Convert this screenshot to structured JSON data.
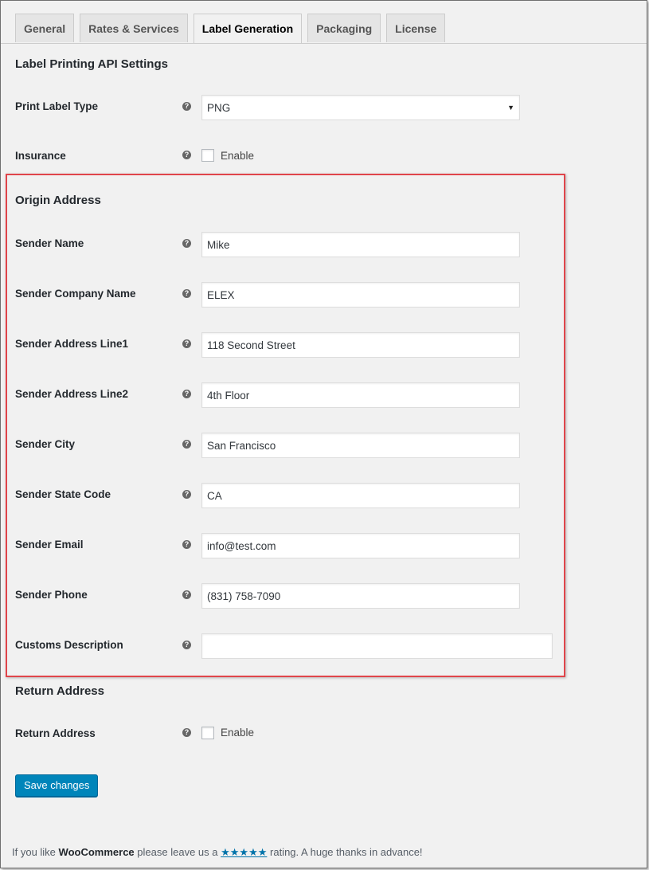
{
  "tabs": [
    "General",
    "Rates & Services",
    "Label Generation",
    "Packaging",
    "License"
  ],
  "active_tab": "Label Generation",
  "api_section": {
    "title": "Label Printing API Settings",
    "print_label_type": {
      "label": "Print Label Type",
      "value": "PNG"
    },
    "insurance": {
      "label": "Insurance",
      "checkbox_label": "Enable",
      "checked": false
    }
  },
  "origin_section": {
    "title": "Origin Address",
    "fields": [
      {
        "label": "Sender Name",
        "value": "Mike"
      },
      {
        "label": "Sender Company Name",
        "value": "ELEX"
      },
      {
        "label": "Sender Address Line1",
        "value": "118 Second Street"
      },
      {
        "label": "Sender Address Line2",
        "value": "4th Floor"
      },
      {
        "label": "Sender City",
        "value": "San Francisco"
      },
      {
        "label": "Sender State Code",
        "value": "CA"
      },
      {
        "label": "Sender Email",
        "value": "info@test.com"
      },
      {
        "label": "Sender Phone",
        "value": "(831) 758-7090"
      },
      {
        "label": "Customs Description",
        "value": ""
      }
    ]
  },
  "return_section": {
    "title": "Return Address",
    "return_address": {
      "label": "Return Address",
      "checkbox_label": "Enable",
      "checked": false
    }
  },
  "save_button": "Save changes",
  "footer": {
    "prefix": "If you like",
    "brand": "WooCommerce",
    "middle": "please leave us a",
    "stars": "★★★★★",
    "suffix": "rating. A huge thanks in advance!"
  },
  "help_icon_glyph": "?",
  "select_arrow_glyph": "▼",
  "colors": {
    "primary_button": "#0085ba",
    "highlight_border": "#e0454b",
    "link": "#0073aa"
  }
}
